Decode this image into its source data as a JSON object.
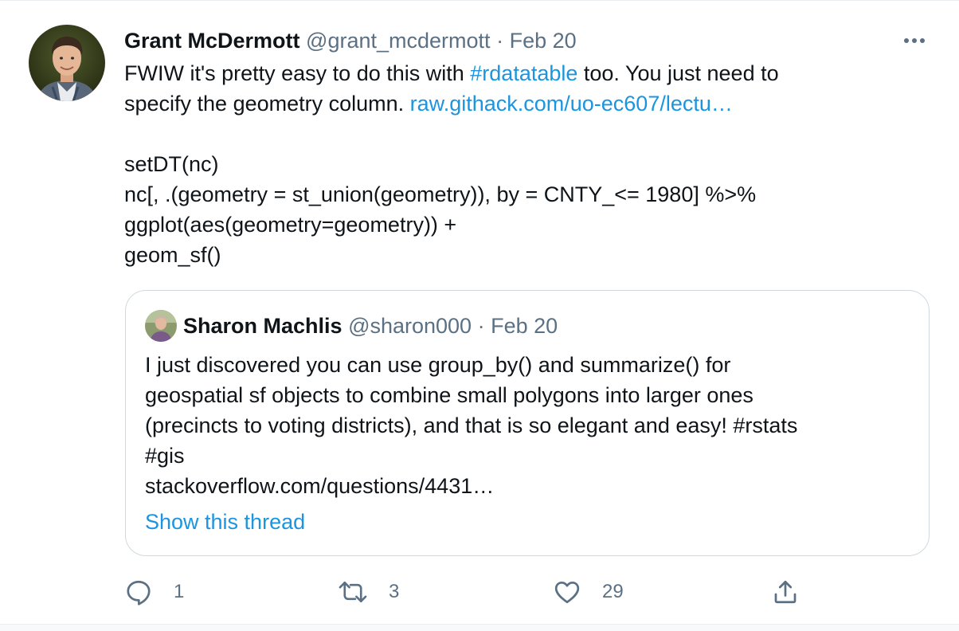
{
  "tweet": {
    "author": {
      "name": "Grant McDermott",
      "handle": "@grant_mcdermott",
      "separator": "·",
      "date": "Feb 20"
    },
    "more_icon": "more-horizontal-icon",
    "text": {
      "line1_prefix": "FWIW it's pretty easy to do this with ",
      "line1_hashtag": "#rdatatable",
      "line1_suffix": " too. You just need to",
      "line2_prefix": "specify the geometry column. ",
      "line2_link": "raw.githack.com/uo-ec607/lectu…",
      "code": [
        "setDT(nc)",
        "nc[, .(geometry = st_union(geometry)), by = CNTY_<= 1980] %>%",
        "ggplot(aes(geometry=geometry)) +",
        "geom_sf()"
      ]
    },
    "quoted": {
      "author": {
        "name": "Sharon Machlis",
        "handle": "@sharon000",
        "separator": "·",
        "date": "Feb 20"
      },
      "lines": [
        "I just discovered you can use group_by() and summarize() for",
        "geospatial sf objects to combine small polygons into larger ones",
        "(precincts to voting districts), and that is so elegant and easy! #rstats",
        "#gis",
        "stackoverflow.com/questions/4431…"
      ],
      "show_thread": "Show this thread"
    },
    "actions": {
      "reply": {
        "icon": "reply-icon",
        "count": "1"
      },
      "retweet": {
        "icon": "retweet-icon",
        "count": "3"
      },
      "like": {
        "icon": "heart-icon",
        "count": "29"
      },
      "share": {
        "icon": "share-icon"
      }
    },
    "colors": {
      "text": "#0f1419",
      "secondary": "#5b7083",
      "link": "#1b95e0",
      "border": "#cfd9de"
    }
  }
}
